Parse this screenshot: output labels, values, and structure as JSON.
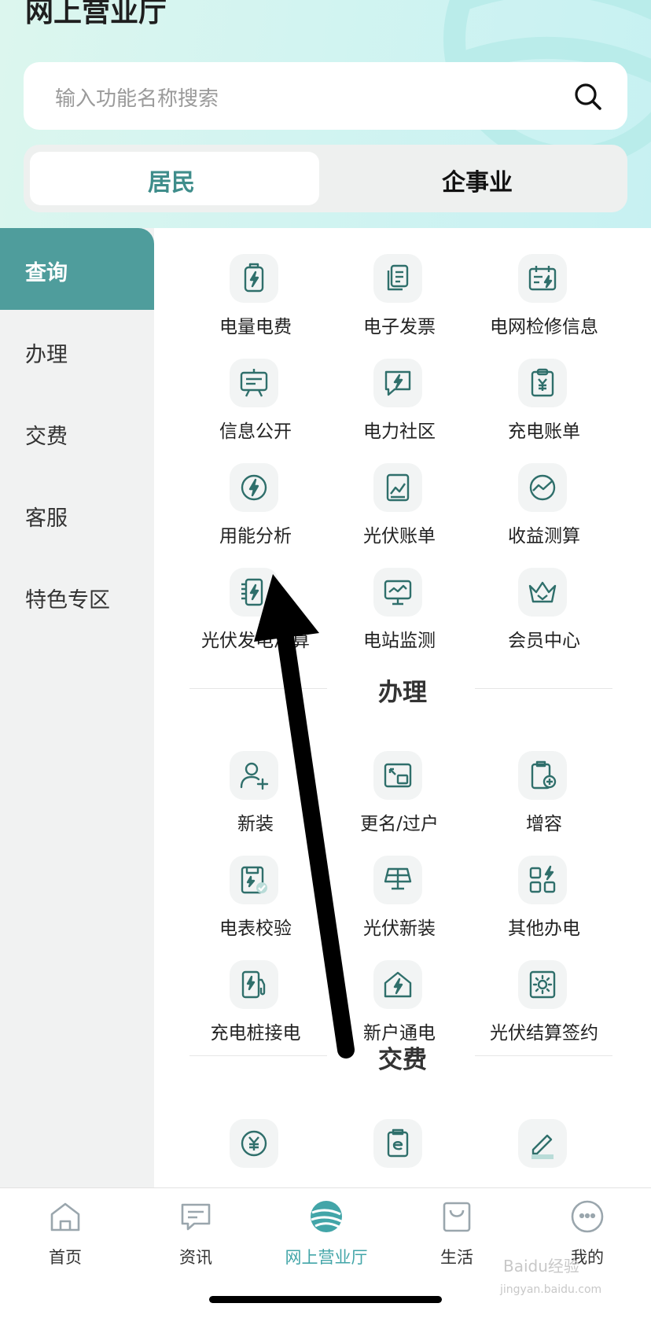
{
  "header": {
    "title": "网上营业厅"
  },
  "search": {
    "placeholder": "输入功能名称搜索"
  },
  "segments": [
    "居民",
    "企事业"
  ],
  "sidebar": {
    "items": [
      {
        "label": "查询",
        "active": true
      },
      {
        "label": "办理"
      },
      {
        "label": "交费"
      },
      {
        "label": "客服"
      },
      {
        "label": "特色专区"
      }
    ]
  },
  "query": {
    "items": [
      {
        "label": "电量电费",
        "icon": "battery-bolt-icon"
      },
      {
        "label": "电子发票",
        "icon": "invoice-icon"
      },
      {
        "label": "电网检修信息",
        "icon": "grid-maintenance-icon"
      },
      {
        "label": "信息公开",
        "icon": "board-icon"
      },
      {
        "label": "电力社区",
        "icon": "chat-bolt-icon"
      },
      {
        "label": "充电账单",
        "icon": "clipboard-yuan-icon"
      },
      {
        "label": "用能分析",
        "icon": "gauge-bolt-icon"
      },
      {
        "label": "光伏账单",
        "icon": "pv-bill-icon"
      },
      {
        "label": "收益测算",
        "icon": "profit-chart-icon"
      },
      {
        "label": "光伏发电测算",
        "icon": "pv-generation-icon"
      },
      {
        "label": "电站监测",
        "icon": "monitor-icon"
      },
      {
        "label": "会员中心",
        "icon": "crown-icon"
      }
    ]
  },
  "handle": {
    "title": "办理",
    "items": [
      {
        "label": "新装",
        "icon": "user-add-icon"
      },
      {
        "label": "更名/过户",
        "icon": "transfer-icon"
      },
      {
        "label": "增容",
        "icon": "capacity-plus-icon"
      },
      {
        "label": "电表校验",
        "icon": "meter-check-icon"
      },
      {
        "label": "光伏新装",
        "icon": "solar-panel-icon"
      },
      {
        "label": "其他办电",
        "icon": "other-grid-icon"
      },
      {
        "label": "充电桩接电",
        "icon": "charging-pile-icon"
      },
      {
        "label": "新户通电",
        "icon": "house-bolt-icon"
      },
      {
        "label": "光伏结算签约",
        "icon": "sun-contract-icon"
      }
    ]
  },
  "pay": {
    "title": "交费",
    "items": [
      {
        "icon": "yuan-circle-icon"
      },
      {
        "icon": "e-bill-icon"
      },
      {
        "icon": "pen-icon"
      }
    ]
  },
  "tabbar": {
    "items": [
      {
        "label": "首页",
        "icon": "home-icon"
      },
      {
        "label": "资讯",
        "icon": "message-icon"
      },
      {
        "label": "网上营业厅",
        "icon": "globe-icon",
        "active": true
      },
      {
        "label": "生活",
        "icon": "bag-icon"
      },
      {
        "label": "我的",
        "icon": "smile-icon"
      }
    ]
  },
  "watermark": {
    "text": "Baidu经验",
    "url": "jingyan.baidu.com"
  },
  "colors": {
    "accent": "#4f9d9c",
    "tab_active": "#42a5a8",
    "icon_stroke": "#2f6f6b"
  }
}
